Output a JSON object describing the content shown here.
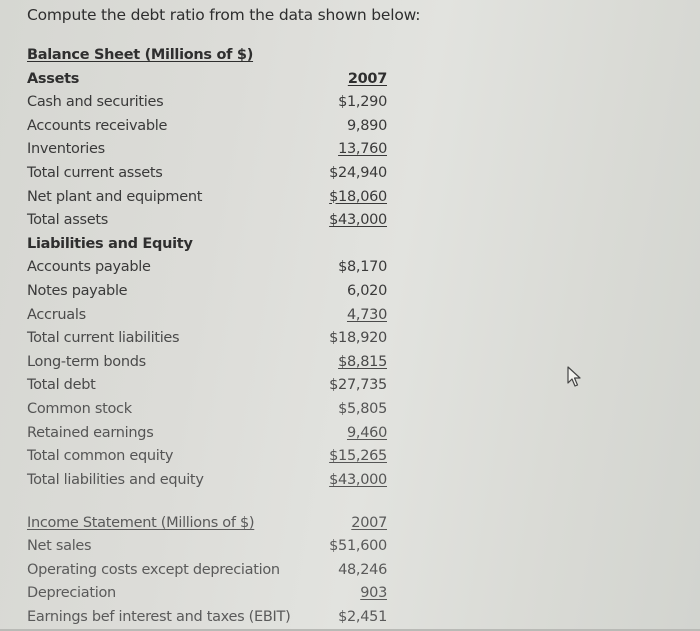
{
  "prompt": "Compute the debt ratio from the data shown below:",
  "balance_sheet": {
    "title": "Balance Sheet  (Millions of $)",
    "year_label": "2007",
    "assets_heading": "Assets",
    "liabilities_heading": "Liabilities and Equity",
    "assets": [
      {
        "label": "Cash and securities",
        "value": "$1,290"
      },
      {
        "label": "Accounts receivable",
        "value": "9,890"
      },
      {
        "label": "Inventories",
        "value": "13,760"
      },
      {
        "label": "Total current assets",
        "value": "$24,940"
      },
      {
        "label": "Net plant and equipment",
        "value": "$18,060"
      },
      {
        "label": "Total assets",
        "value": "$43,000"
      }
    ],
    "liabilities": [
      {
        "label": "Accounts payable",
        "value": "$8,170"
      },
      {
        "label": "Notes payable",
        "value": "6,020"
      },
      {
        "label": "Accruals",
        "value": "4,730"
      },
      {
        "label": "Total current liabilities",
        "value": "$18,920"
      },
      {
        "label": "Long-term bonds",
        "value": "$8,815"
      },
      {
        "label": "Total debt",
        "value": "$27,735"
      },
      {
        "label": "Common stock",
        "value": "$5,805"
      },
      {
        "label": "Retained earnings",
        "value": "9,460"
      },
      {
        "label": "Total common equity",
        "value": "$15,265"
      },
      {
        "label": "Total liabilities and equity",
        "value": "$43,000"
      }
    ]
  },
  "income_statement": {
    "title": "Income Statement (Millions of $)",
    "year_label": "2007",
    "rows": [
      {
        "label": "Net sales",
        "value": "$51,600"
      },
      {
        "label": "Operating costs except depreciation",
        "value": "48,246"
      },
      {
        "label": "Depreciation",
        "value": "903"
      },
      {
        "label": "Earnings bef interest and taxes (EBIT)",
        "value": "$2,451"
      }
    ]
  },
  "cursor_icon": "arrow-pointer-icon"
}
